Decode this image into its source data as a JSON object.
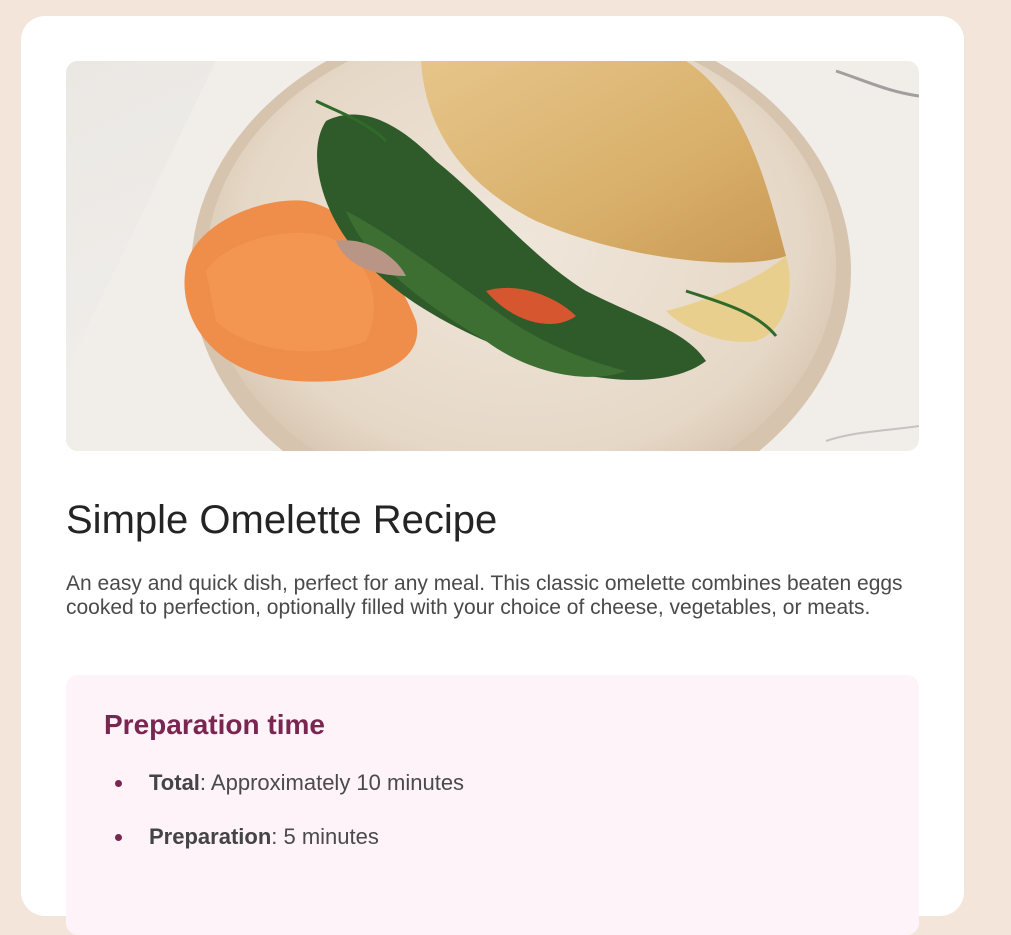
{
  "recipe": {
    "image_alt": "Omelette with spinach, dill and carrot spread on a ceramic plate",
    "title": "Simple Omelette Recipe",
    "description": "An easy and quick dish, perfect for any meal. This classic omelette combines beaten eggs cooked to perfection, optionally filled with your choice of cheese, vegetables, or meats."
  },
  "preparation": {
    "heading": "Preparation time",
    "items": [
      {
        "label": "Total",
        "value": ": Approximately 10 minutes"
      },
      {
        "label": "Preparation",
        "value": ": 5 minutes"
      }
    ]
  },
  "colors": {
    "page_background": "#f3e5da",
    "card_background": "#ffffff",
    "accent": "#7a2650",
    "prep_background": "#fdf3f9"
  }
}
